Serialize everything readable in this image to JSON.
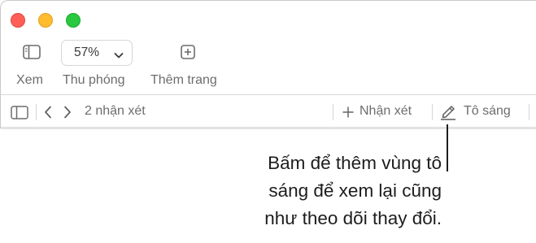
{
  "toolbar": {
    "view_label": "Xem",
    "zoom_label": "Thu phóng",
    "zoom_value": "57%",
    "add_page_label": "Thêm trang"
  },
  "comments_bar": {
    "count_label": "2 nhận xét",
    "add_comment_label": "Nhận xét",
    "highlight_label": "Tô sáng"
  },
  "callout": {
    "lines": [
      "Bấm để thêm vùng tô",
      "sáng để xem lại cũng",
      "như theo dõi thay đổi."
    ]
  },
  "icons": {
    "view": "sidebar-icon",
    "zoom_chevron": "chevron-down-icon",
    "add_page": "plus-square-icon",
    "comments_sidebar": "sidebar-icon",
    "previous": "chevron-left-icon",
    "next": "chevron-right-icon",
    "add_comment": "plus-icon",
    "highlight": "pen-icon"
  },
  "colors": {
    "close": "#ff5f57",
    "minimize": "#febc2e",
    "zoom": "#28c840",
    "toolbar_text": "#6d6d6d"
  }
}
